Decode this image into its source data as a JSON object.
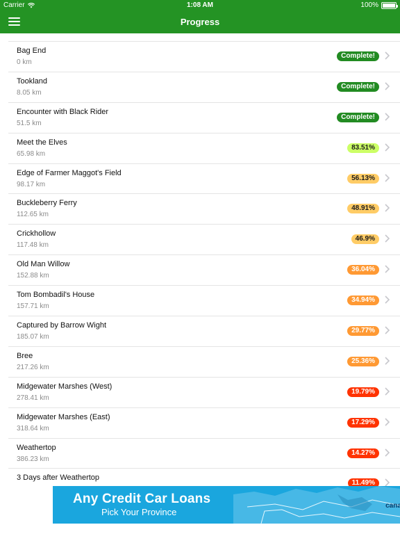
{
  "status": {
    "carrier": "Carrier",
    "time": "1:08 AM",
    "battery": "100%"
  },
  "nav": {
    "title": "Progress"
  },
  "colors": {
    "brand_green": "#249324",
    "complete": "#228B22",
    "high": "#ccff66",
    "mid": "#ffcc66",
    "low": "#ff9933",
    "critical": "#ff3300"
  },
  "items": [
    {
      "name": "Bag End",
      "distance": "0 km",
      "badge": "Complete!",
      "level": "complete"
    },
    {
      "name": "Tookland",
      "distance": "8.05 km",
      "badge": "Complete!",
      "level": "complete"
    },
    {
      "name": "Encounter with Black Rider",
      "distance": "51.5 km",
      "badge": "Complete!",
      "level": "complete"
    },
    {
      "name": "Meet the Elves",
      "distance": "65.98 km",
      "badge": "83.51%",
      "level": "high"
    },
    {
      "name": "Edge of Farmer Maggot's Field",
      "distance": "98.17 km",
      "badge": "56.13%",
      "level": "mid"
    },
    {
      "name": "Buckleberry Ferry",
      "distance": "112.65 km",
      "badge": "48.91%",
      "level": "mid"
    },
    {
      "name": "Crickhollow",
      "distance": "117.48 km",
      "badge": "46.9%",
      "level": "mid"
    },
    {
      "name": "Old Man Willow",
      "distance": "152.88 km",
      "badge": "36.04%",
      "level": "low"
    },
    {
      "name": "Tom Bombadil's House",
      "distance": "157.71 km",
      "badge": "34.94%",
      "level": "low"
    },
    {
      "name": "Captured by Barrow Wight",
      "distance": "185.07 km",
      "badge": "29.77%",
      "level": "low"
    },
    {
      "name": "Bree",
      "distance": "217.26 km",
      "badge": "25.36%",
      "level": "low"
    },
    {
      "name": "Midgewater Marshes (West)",
      "distance": "278.41 km",
      "badge": "19.79%",
      "level": "critical"
    },
    {
      "name": "Midgewater Marshes (East)",
      "distance": "318.64 km",
      "badge": "17.29%",
      "level": "critical"
    },
    {
      "name": "Weathertop",
      "distance": "386.23 km",
      "badge": "14.27%",
      "level": "critical"
    },
    {
      "name": "3 Days after Weathertop",
      "distance": "",
      "badge": "11.49%",
      "level": "critical"
    }
  ],
  "ad": {
    "headline": "Any Credit Car Loans",
    "sub": "Pick Your Province",
    "brand": "canad"
  }
}
